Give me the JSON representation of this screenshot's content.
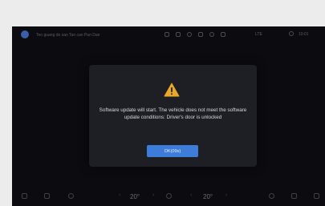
{
  "statusbar": {
    "location": "Teo guang do san Tan can Pan Dan",
    "network": "LTE",
    "time": "10:01"
  },
  "dialog": {
    "icon": "warning-triangle-icon",
    "message": "Software update will start. The vehicle does not meet the software update conditions: Driver's door is unlocked",
    "button_label": "OK(09s)"
  },
  "dock": {
    "temp_left": "20°",
    "temp_right": "20°"
  },
  "colors": {
    "accent": "#3d7dd9",
    "warning": "#e9a825",
    "background": "#0c0c10",
    "dialog": "#1d1f24"
  }
}
